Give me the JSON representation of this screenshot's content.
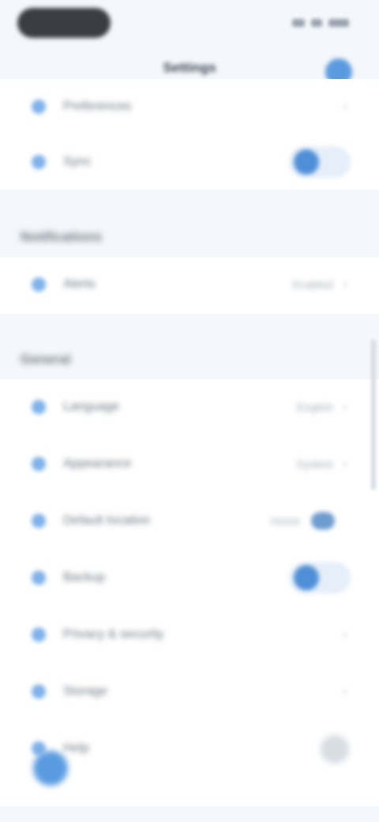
{
  "status_bar": {
    "time": ""
  },
  "header": {
    "title": "Settings"
  },
  "sections": [
    {
      "title": "",
      "rows": [
        {
          "label": "Preferences",
          "value": "",
          "control": "chevron"
        },
        {
          "label": "Sync",
          "value": "",
          "control": "toggle",
          "on": true
        }
      ]
    },
    {
      "title": "Notifications",
      "rows": [
        {
          "label": "Alerts",
          "value": "Enabled",
          "control": "chevron"
        }
      ]
    },
    {
      "title": "General",
      "rows": [
        {
          "label": "Language",
          "value": "English",
          "control": "chevron"
        },
        {
          "label": "Appearance",
          "value": "System",
          "control": "chevron"
        },
        {
          "label": "Default location",
          "value": "Home",
          "control": "mini-toggle"
        },
        {
          "label": "Backup",
          "value": "",
          "control": "toggle",
          "on": true
        },
        {
          "label": "Privacy & security",
          "value": "",
          "control": "chevron"
        },
        {
          "label": "Storage",
          "value": "",
          "control": "chevron"
        },
        {
          "label": "Help",
          "value": "",
          "control": "grey-dot"
        }
      ]
    }
  ],
  "colors": {
    "accent": "#4f8fd8",
    "background": "#f4f7fb",
    "card": "#ffffff"
  },
  "icons": {
    "avatar": "user-icon",
    "row_icon": "setting-icon",
    "chevron": "chevron-right-icon",
    "fab": "plus-icon"
  }
}
